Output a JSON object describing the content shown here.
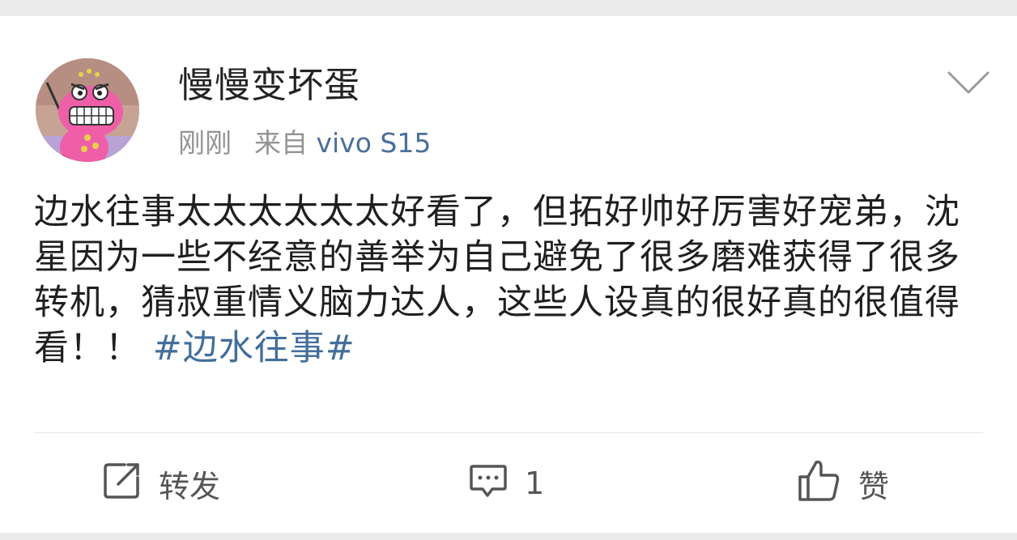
{
  "post": {
    "user": {
      "name": "慢慢变坏蛋",
      "avatar_icon": "pink-crocodile-avatar"
    },
    "meta": {
      "time": "刚刚",
      "source_prefix": "来自",
      "device": "vivo S15"
    },
    "menu_icon": "chevron-down-icon",
    "content": {
      "text": "边水往事太太太太太太好看了，但拓好帅好厉害好宠弟，沈星因为一些不经意的善举为自己避免了很多磨难获得了很多转机，猜叔重情义脑力达人，这些人设真的很好真的很值得看！！",
      "topic": "#边水往事#"
    },
    "actions": {
      "repost_label": "转发",
      "comment_count": "1",
      "like_label": "赞"
    }
  },
  "colors": {
    "background": "#ececec",
    "card": "#ffffff",
    "link": "#436e9c",
    "meta_gray": "#939393"
  }
}
